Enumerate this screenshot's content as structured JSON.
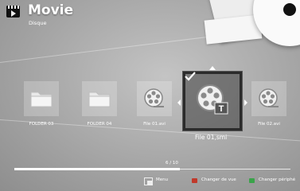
{
  "header": {
    "title": "Movie",
    "subtitle": "Disque",
    "icon": "movie-clapper-icon"
  },
  "items": [
    {
      "label": "FOLDER 03",
      "type": "folder",
      "icon": "folder-icon"
    },
    {
      "label": "FOLDER 04",
      "type": "folder",
      "icon": "folder-icon"
    },
    {
      "label": "File 01.avi",
      "type": "movie",
      "icon": "film-reel-icon"
    },
    {
      "label": "File 01,smi",
      "type": "subtitle",
      "icon": "film-reel-subtitle-icon",
      "selected": true,
      "checked": true
    },
    {
      "label": "File 02.avi",
      "type": "movie",
      "icon": "film-reel-icon"
    }
  ],
  "page": {
    "indicator": "6 / 10",
    "progress": 0.6
  },
  "footer": {
    "buttons": [
      {
        "label": "Menu",
        "icon": "menu-icon"
      },
      {
        "label": "Changer de vue",
        "icon": "red-button-icon",
        "color": "#c0392b"
      },
      {
        "label": "Changer périphé",
        "icon": "green-button-icon",
        "color": "#3aa34a"
      }
    ]
  },
  "colors": {
    "background": "#a6a6a6",
    "selection_border": "#2b2b2b",
    "text": "#ffffff"
  }
}
